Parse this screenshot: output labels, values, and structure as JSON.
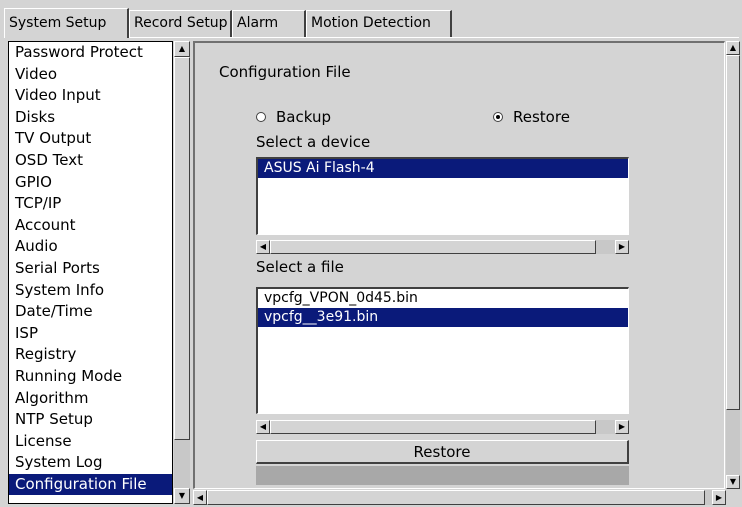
{
  "tabs": [
    {
      "label": "System Setup",
      "active": true
    },
    {
      "label": "Record Setup",
      "active": false
    },
    {
      "label": "Alarm",
      "active": false
    },
    {
      "label": "Motion Detection",
      "active": false
    }
  ],
  "sidebar": {
    "items": [
      {
        "label": "Password Protect"
      },
      {
        "label": "Video"
      },
      {
        "label": "Video Input"
      },
      {
        "label": "Disks"
      },
      {
        "label": "TV Output"
      },
      {
        "label": "OSD Text"
      },
      {
        "label": "GPIO"
      },
      {
        "label": "TCP/IP"
      },
      {
        "label": "Account"
      },
      {
        "label": "Audio"
      },
      {
        "label": "Serial Ports"
      },
      {
        "label": "System Info"
      },
      {
        "label": "Date/Time"
      },
      {
        "label": "ISP"
      },
      {
        "label": "Registry"
      },
      {
        "label": "Running Mode"
      },
      {
        "label": "Algorithm"
      },
      {
        "label": "NTP Setup"
      },
      {
        "label": "License"
      },
      {
        "label": "System Log"
      },
      {
        "label": "Configuration File",
        "selected": true
      }
    ]
  },
  "panel": {
    "title": "Configuration File",
    "mode": {
      "backup_label": "Backup",
      "restore_label": "Restore",
      "selected": "restore"
    },
    "device": {
      "label": "Select a device",
      "items": [
        {
          "label": "ASUS Ai Flash-4",
          "selected": true
        }
      ]
    },
    "file": {
      "label": "Select a file",
      "items": [
        {
          "label": "vpcfg_VPON_0d45.bin",
          "selected": false
        },
        {
          "label": "vpcfg__3e91.bin",
          "selected": true
        }
      ]
    },
    "restore_button": "Restore"
  },
  "colors": {
    "background": "#d4d4d4",
    "selection": "#0a1a7a",
    "selection_text": "#ffffff"
  },
  "icons": {
    "scroll_up": "up-arrow-icon",
    "scroll_down": "down-arrow-icon",
    "scroll_left": "left-arrow-icon",
    "scroll_right": "right-arrow-icon"
  }
}
